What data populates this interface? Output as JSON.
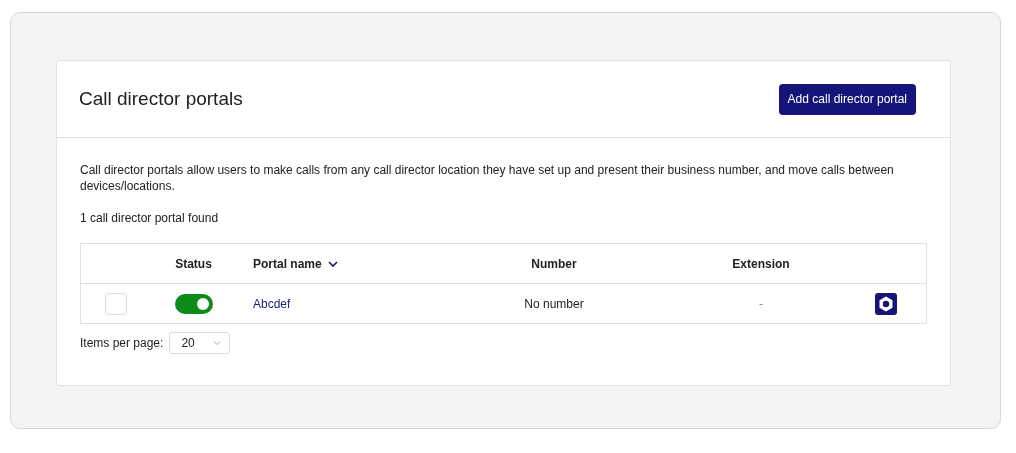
{
  "card": {
    "title": "Call director portals",
    "add_button": "Add call director portal",
    "description": "Call director portals allow users to make calls from any call director location they have set up and present their business number, and move calls between devices/locations.",
    "count": "1 call director portal found"
  },
  "table": {
    "columns": [
      {},
      {
        "label": "Status"
      },
      {
        "label": "Portal name",
        "sorted": true
      },
      {
        "label": "Number"
      },
      {
        "label": "Extension"
      },
      {}
    ],
    "rows": [
      {
        "checked": false,
        "on": true,
        "name": "Abcdef",
        "number": "No number",
        "extension": "-"
      }
    ]
  },
  "pagination": {
    "label": "Items per page:",
    "value": "20"
  }
}
